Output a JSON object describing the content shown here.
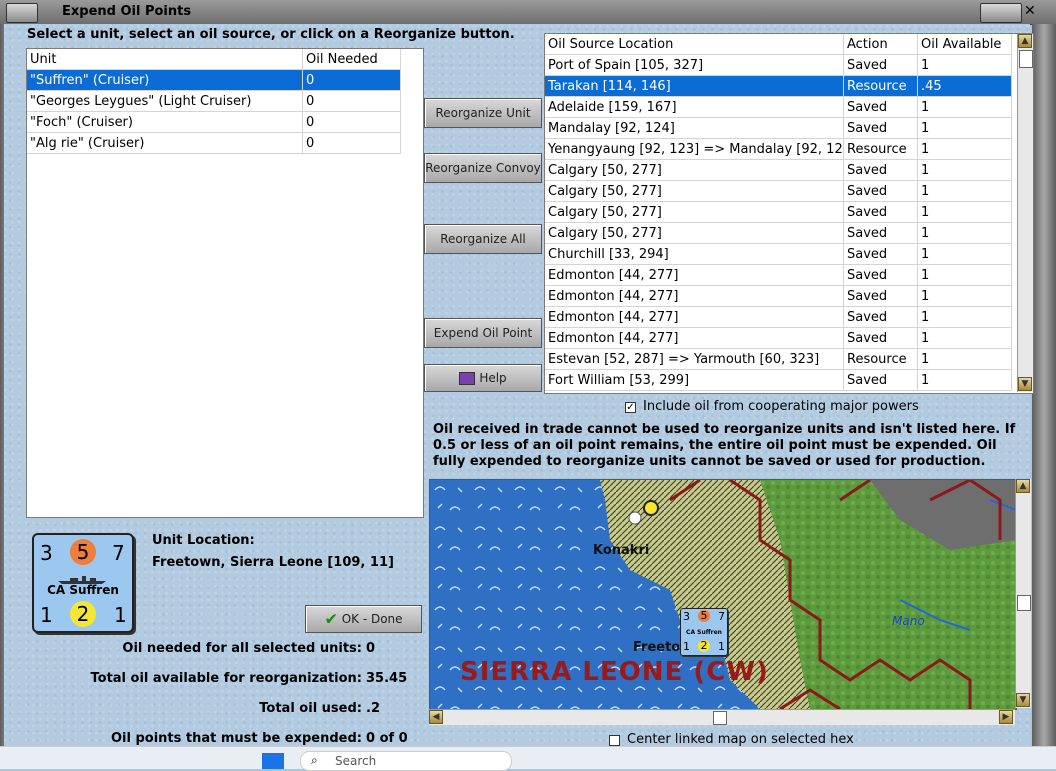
{
  "window": {
    "title": "Expend Oil Points"
  },
  "instruction": "Select a unit, select an oil source, or click on a Reorganize button.",
  "units_table": {
    "headers": [
      "Unit",
      "Oil Needed"
    ],
    "rows": [
      {
        "unit": "\"Suffren\" (Cruiser)",
        "oil": "0",
        "selected": true
      },
      {
        "unit": "\"Georges Leygues\" (Light Cruiser)",
        "oil": "0"
      },
      {
        "unit": "\"Foch\" (Cruiser)",
        "oil": "0"
      },
      {
        "unit": "\"Alg rie\" (Cruiser)",
        "oil": "0"
      }
    ]
  },
  "buttons": {
    "reorganize_unit": "Reorganize Unit",
    "reorganize_convoy": "Reorganize Convoy",
    "reorganize_all": "Reorganize All",
    "expend_oil_point": "Expend Oil Point",
    "help": "Help",
    "ok_done": "OK - Done"
  },
  "sources_table": {
    "headers": [
      "Oil Source Location",
      "Action",
      "Oil Available"
    ],
    "rows": [
      {
        "loc": "Port of Spain [105, 327]",
        "action": "Saved",
        "avail": "1"
      },
      {
        "loc": "Tarakan [114, 146]",
        "action": "Resource",
        "avail": ".45",
        "selected": true
      },
      {
        "loc": "Adelaide [159, 167]",
        "action": "Saved",
        "avail": "1"
      },
      {
        "loc": "Mandalay [92, 124]",
        "action": "Saved",
        "avail": "1"
      },
      {
        "loc": "Yenangyaung [92, 123] => Mandalay [92, 124]",
        "action": "Resource",
        "avail": "1"
      },
      {
        "loc": "Calgary [50, 277]",
        "action": "Saved",
        "avail": "1"
      },
      {
        "loc": "Calgary [50, 277]",
        "action": "Saved",
        "avail": "1"
      },
      {
        "loc": "Calgary [50, 277]",
        "action": "Saved",
        "avail": "1"
      },
      {
        "loc": "Calgary [50, 277]",
        "action": "Saved",
        "avail": "1"
      },
      {
        "loc": "Churchill [33, 294]",
        "action": "Saved",
        "avail": "1"
      },
      {
        "loc": "Edmonton [44, 277]",
        "action": "Saved",
        "avail": "1"
      },
      {
        "loc": "Edmonton [44, 277]",
        "action": "Saved",
        "avail": "1"
      },
      {
        "loc": "Edmonton [44, 277]",
        "action": "Saved",
        "avail": "1"
      },
      {
        "loc": "Edmonton [44, 277]",
        "action": "Saved",
        "avail": "1"
      },
      {
        "loc": "Estevan [52, 287] => Yarmouth [60, 323]",
        "action": "Resource",
        "avail": "1"
      },
      {
        "loc": "Fort William [53, 299]",
        "action": "Saved",
        "avail": "1"
      }
    ]
  },
  "include_oil_checkbox": {
    "label": "Include oil from cooperating major powers",
    "checked": true
  },
  "note": "Oil received in trade cannot be used to reorganize units and isn't listed here.  If 0.5 or less of an oil point remains, the entire oil point must be expended.   Oil fully expended to reorganize units cannot be saved or used for production.",
  "unit_counter": {
    "attack": "3",
    "defense": "5",
    "move": "7",
    "name": "CA Suffren",
    "range": "1",
    "cost": "2",
    "extra": "1"
  },
  "unit_location": {
    "label": "Unit Location:",
    "value": "Freetown, Sierra Leone [109, 11]"
  },
  "stats": {
    "oil_needed_label": "Oil needed for all selected units:",
    "oil_needed": "0",
    "total_available_label": "Total oil available for reorganization:",
    "total_available": "35.45",
    "total_used_label": "Total oil used:",
    "total_used": ".2",
    "must_expend_label": "Oil points that must be expended:",
    "must_expend": "0 of 0"
  },
  "map": {
    "region_label": "SIERRA LEONE (CW)",
    "city_konakri": "Konakri",
    "city_freetown": "Freeto",
    "river_label": "Mano",
    "counter": {
      "attack": "3",
      "defense": "5",
      "move": "7",
      "name": "CA Suffren",
      "range": "1",
      "cost": "2",
      "extra": "1"
    }
  },
  "center_map_checkbox": {
    "label": "Center linked map on selected hex",
    "checked": false
  },
  "taskbar": {
    "search_placeholder": "Search"
  }
}
